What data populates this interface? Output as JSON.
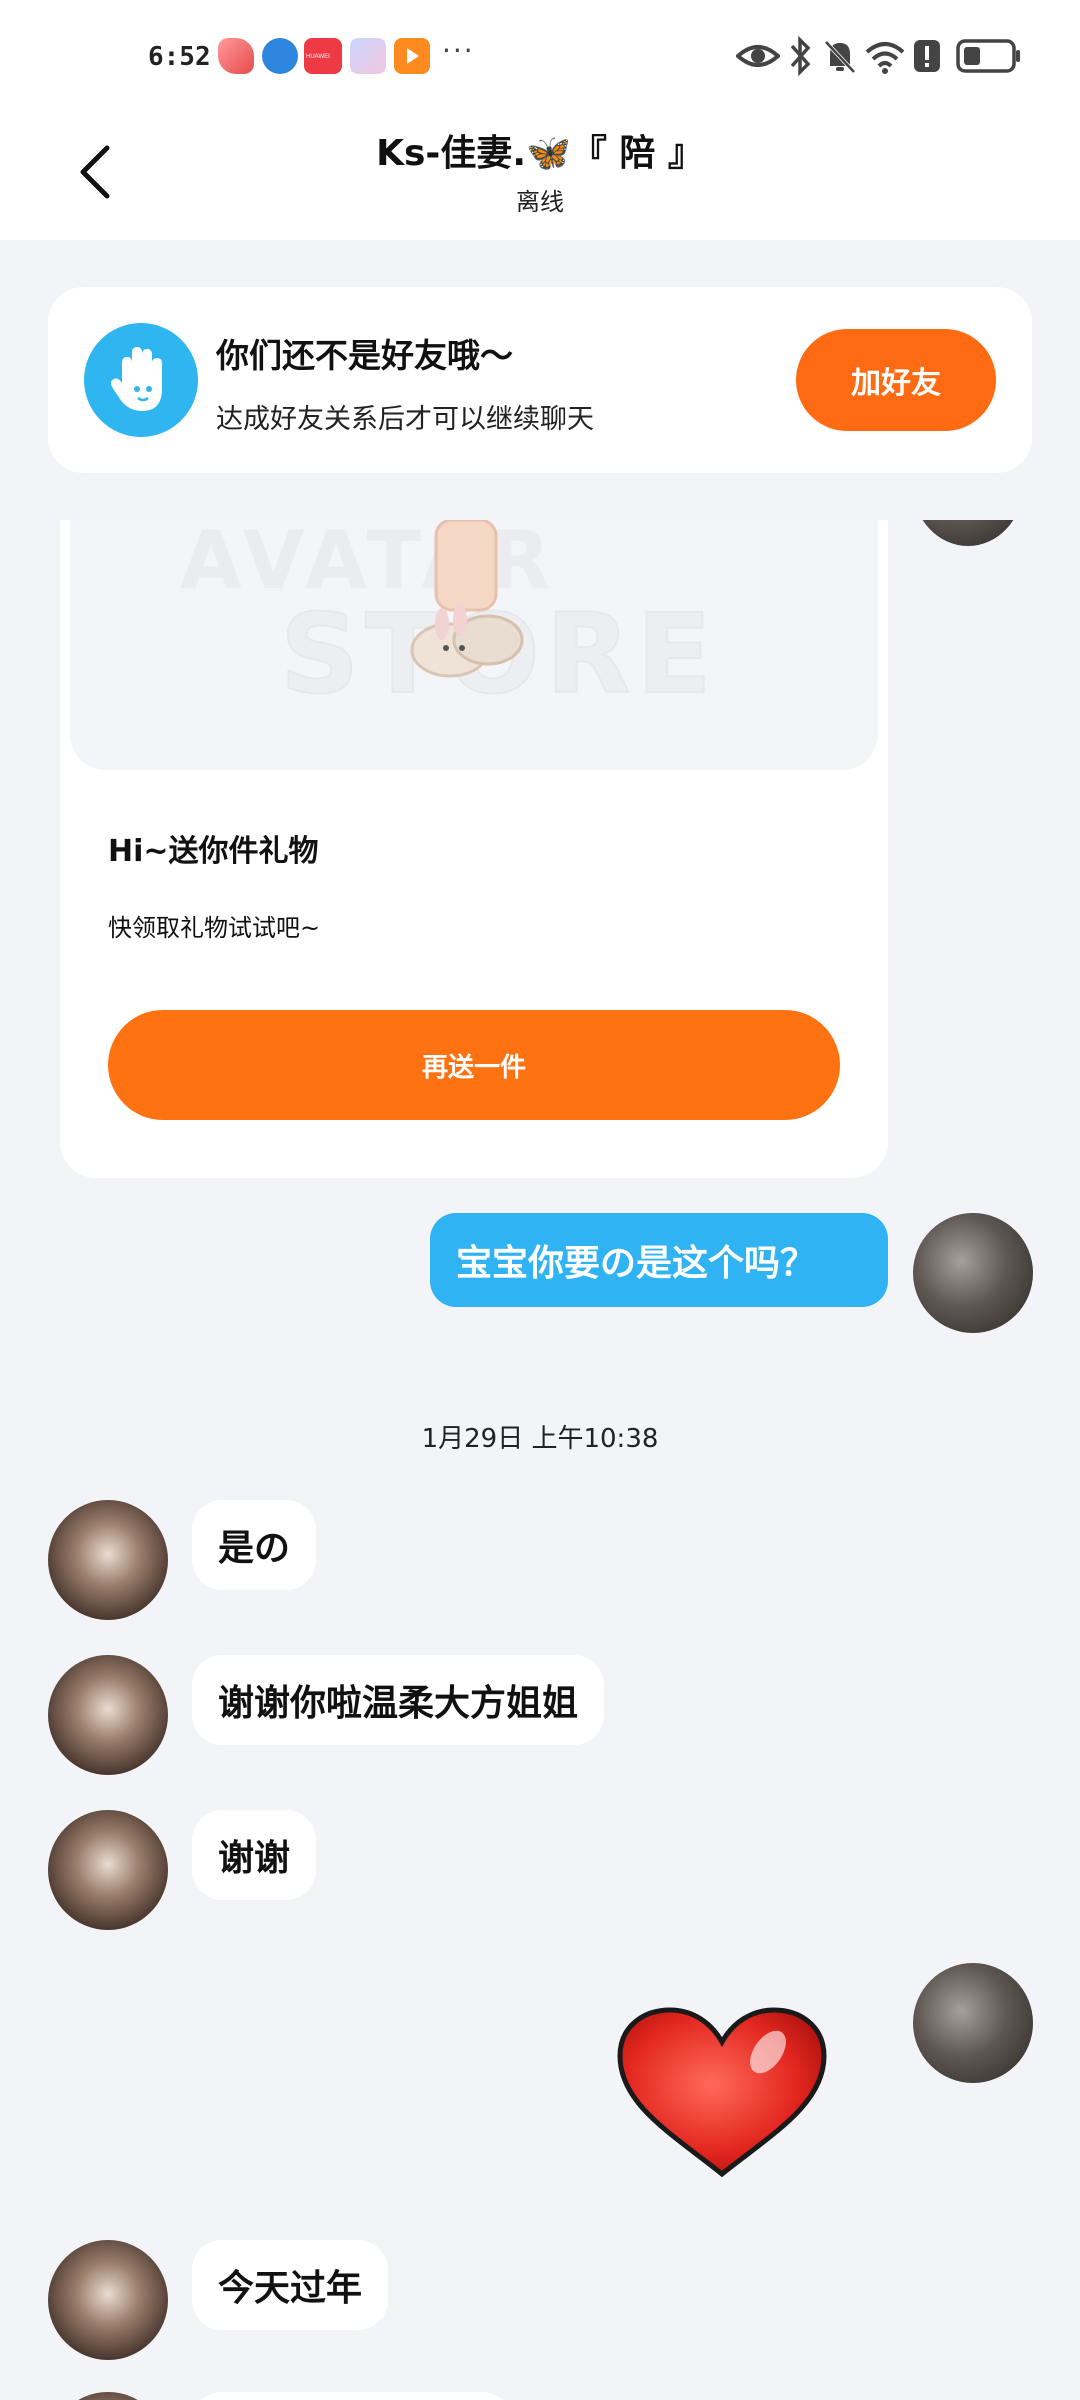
{
  "status_bar": {
    "time": "6:52",
    "notification_icons": [
      "app-icon",
      "browser-icon",
      "huawei-store-icon",
      "anime-app-icon",
      "video-app-icon"
    ],
    "huawei_label": "HUAWEI",
    "more": "···",
    "right_icons": [
      "eye-icon",
      "bluetooth-icon",
      "mute-bell-icon",
      "wifi-icon",
      "alert-icon",
      "battery-icon"
    ]
  },
  "header": {
    "title": "Ks-佳妻.🦋『 陪 』",
    "status": "离线"
  },
  "friend_banner": {
    "title": "你们还不是好友哦～",
    "subtitle": "达成好友关系后才可以继续聊天",
    "button": "加好友"
  },
  "gift_card": {
    "watermark_line1": "AVATAR",
    "watermark_line2": "STORE",
    "title": "Hi~送你件礼物",
    "description": "快领取礼物试试吧~",
    "button": "再送一件"
  },
  "messages": [
    {
      "from": "me",
      "text": "宝宝你要の是这个吗？"
    },
    {
      "timestamp": "1月29日 上午10:38"
    },
    {
      "from": "other",
      "text": "是の"
    },
    {
      "from": "other",
      "text": "谢谢你啦温柔大方姐姐"
    },
    {
      "from": "other",
      "text": "谢谢"
    },
    {
      "from": "me",
      "sticker": "heart"
    },
    {
      "from": "other",
      "text": "今天过年"
    }
  ],
  "colors": {
    "accent_orange": "#ff6a12",
    "bubble_blue": "#30b3f2",
    "background": "#f2f4f7"
  }
}
